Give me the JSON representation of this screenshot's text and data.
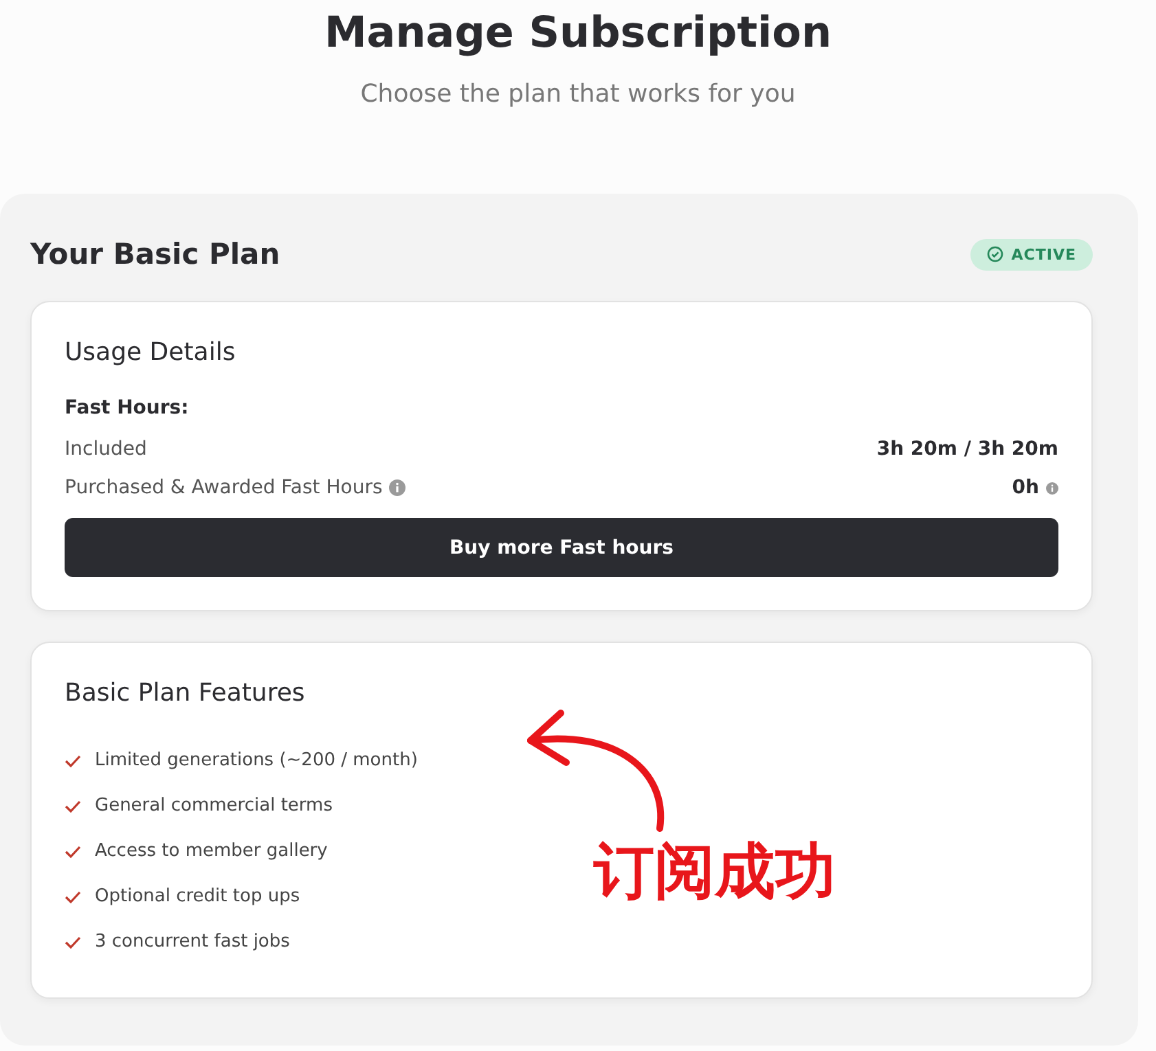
{
  "header": {
    "title": "Manage Subscription",
    "subtitle": "Choose the plan that works for you"
  },
  "plan": {
    "title": "Your Basic Plan",
    "status": {
      "label": "ACTIVE",
      "kind": "active"
    },
    "usage": {
      "title": "Usage Details",
      "section": "Fast Hours:",
      "rows": [
        {
          "label": "Included",
          "value": "3h 20m / 3h 20m",
          "info": false
        },
        {
          "label": "Purchased & Awarded Fast Hours",
          "value": "0h",
          "info": true
        }
      ],
      "button": "Buy more Fast hours"
    },
    "features": {
      "title": "Basic Plan Features",
      "items": [
        "Limited generations (~200 / month)",
        "General commercial terms",
        "Access to member gallery",
        "Optional credit top ups",
        "3 concurrent fast jobs"
      ]
    }
  },
  "annotation": {
    "text": "订阅成功",
    "color": "#e8161b"
  }
}
